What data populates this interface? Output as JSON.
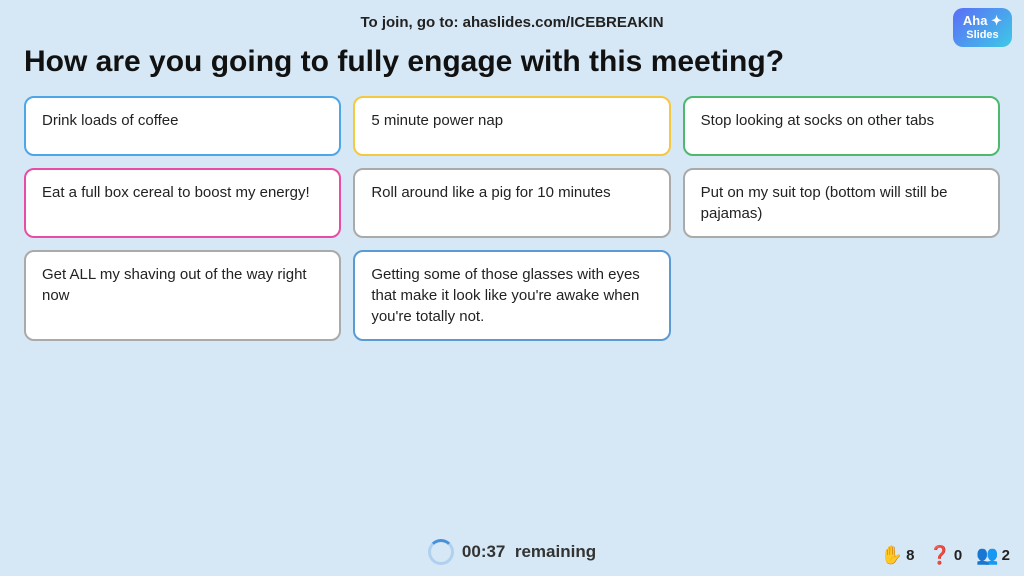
{
  "topbar": {
    "join_text": "To join, go to: ",
    "join_url": "ahaslides.com/ICEBREAKIN"
  },
  "logo": {
    "line1": "Aha ✦",
    "line2": "Slides"
  },
  "question": {
    "text": "How are you going to fully engage with this meeting?"
  },
  "cards": [
    {
      "id": 1,
      "text": "Drink loads of coffee",
      "border": "border-blue"
    },
    {
      "id": 2,
      "text": "5 minute power nap",
      "border": "border-yellow"
    },
    {
      "id": 3,
      "text": "Stop looking at socks on other tabs",
      "border": "border-green"
    },
    {
      "id": 4,
      "text": "Eat a full box cereal to boost my energy!",
      "border": "border-pink"
    },
    {
      "id": 5,
      "text": "Roll around like a pig for 10 minutes",
      "border": "border-gray"
    },
    {
      "id": 6,
      "text": "Put on my suit top (bottom will still be pajamas)",
      "border": "border-gray"
    },
    {
      "id": 7,
      "text": "Get ALL my shaving out of the way right now",
      "border": "border-gray"
    },
    {
      "id": 8,
      "text": "Getting some of those glasses with eyes that make it look like you're awake when you're totally not.",
      "border": "border-blue2"
    }
  ],
  "timer": {
    "time": "00:37",
    "label": "remaining"
  },
  "stats": {
    "hands": "8",
    "questions": "0",
    "users": "2"
  }
}
